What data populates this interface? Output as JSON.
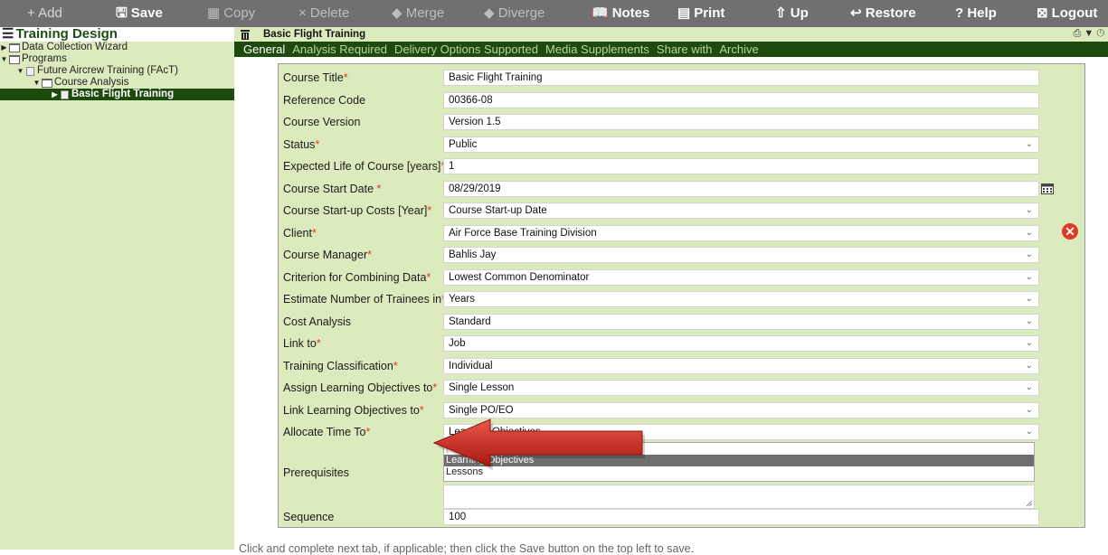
{
  "toolbar": {
    "add": "+ Add",
    "save": "Save",
    "copy": "Copy",
    "delete": "× Delete",
    "merge": "◆ Merge",
    "diverge": "◆ Diverge",
    "notes": "Notes",
    "print": "Print",
    "up": "⇧ Up",
    "restore": "↩ Restore",
    "help": "? Help",
    "logout": "Logout"
  },
  "left_panel": {
    "title": "Training Design",
    "tree": [
      {
        "label": "Data Collection Wizard"
      },
      {
        "label": "Programs"
      },
      {
        "label": "Future Aircrew Training (FAcT)"
      },
      {
        "label": "Course Analysis"
      },
      {
        "label": "Basic Flight Training"
      }
    ]
  },
  "record": {
    "title": "Basic Flight Training"
  },
  "tabs": [
    "General",
    "Analysis Required",
    "Delivery Options Supported",
    "Media Supplements",
    "Share with",
    "Archive"
  ],
  "form": {
    "fields": [
      {
        "label": "Course Title",
        "required": "*",
        "value": "Basic Flight Training",
        "type": "text"
      },
      {
        "label": "Reference Code",
        "required": "",
        "value": "00366-08",
        "type": "text"
      },
      {
        "label": "Course Version",
        "required": "",
        "value": "Version 1.5",
        "type": "text"
      },
      {
        "label": "Status",
        "required": "*",
        "value": "Public",
        "type": "select"
      },
      {
        "label": "Expected Life of Course [years]",
        "required": "*",
        "value": "1",
        "type": "text"
      },
      {
        "label": "Course Start Date ",
        "required": "*",
        "value": "08/29/2019",
        "type": "text"
      },
      {
        "label": "Course Start-up Costs [Year]",
        "required": "*",
        "value": "Course Start-up Date",
        "type": "select"
      },
      {
        "label": "Client",
        "required": "*",
        "value": "Air Force Base Training Division",
        "type": "select"
      },
      {
        "label": "Course Manager",
        "required": "*",
        "value": "Bahlis Jay",
        "type": "select"
      },
      {
        "label": "Criterion for Combining Data",
        "required": "*",
        "value": "Lowest Common Denominator",
        "type": "select"
      },
      {
        "label": "Estimate Number of Trainees in",
        "required": "*",
        "value": "Years",
        "type": "select"
      },
      {
        "label": "Cost Analysis",
        "required": "",
        "value": "Standard",
        "type": "select"
      },
      {
        "label": "Link to",
        "required": "*",
        "value": "Job",
        "type": "select"
      },
      {
        "label": "Training Classification",
        "required": "*",
        "value": "Individual",
        "type": "select"
      },
      {
        "label": "Assign Learning Objectives to",
        "required": "*",
        "value": "Single Lesson",
        "type": "select"
      },
      {
        "label": "Link Learning Objectives to",
        "required": "*",
        "value": "Single PO/EO",
        "type": "select"
      },
      {
        "label": "Allocate Time To",
        "required": "*",
        "value": "Learning Objectives",
        "type": "select"
      }
    ],
    "allocate_options": [
      "[ select ]",
      "Learning Objectives",
      "Lessons"
    ],
    "prerequisites_label": "Prerequisites",
    "sequence_label": "Sequence",
    "sequence_value": "100"
  },
  "footer_text": "Click and complete next tab, if applicable; then click the Save button on the top left to save.",
  "colors": {
    "toolbar_bg": "#707070",
    "panel_green": "#dcebbd",
    "dark_green": "#1e4a0e",
    "required_red": "#e23b2a",
    "arrow_red": "#c8251a"
  }
}
